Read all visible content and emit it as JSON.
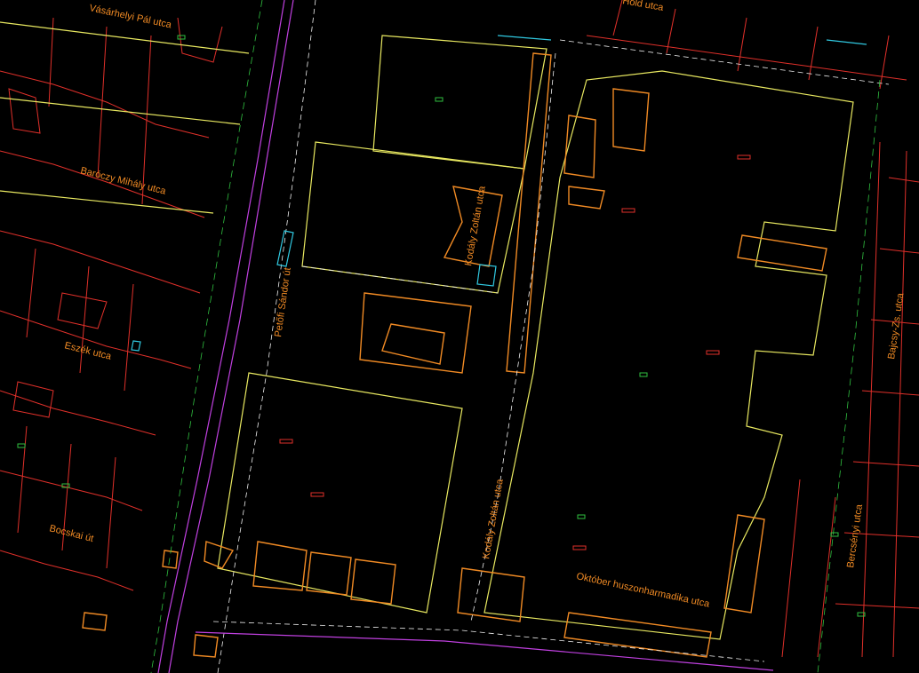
{
  "map": {
    "background": "#000000",
    "colors": {
      "parcel": "#e0302a",
      "building": "#f08a24",
      "block": "#e8e860",
      "tram": "#c040e0",
      "road_line": "#f0f0f0",
      "green_line": "#30c040",
      "cyan": "#30c8e0"
    },
    "street_labels": {
      "vasarhelyi": "Vásárhelyi Pál utca",
      "bercsenyi": "Baróczy Mihály utca",
      "ezzolo": "Eszék utca",
      "bocskai": "Bocskai út",
      "petofi": "Petőfi Sándor út",
      "kodaly_top": "Kodály Zoltán utca",
      "kodaly_bottom": "Kodály Zoltán utca",
      "okt23": "Október huszonharmadika utca",
      "right_1": "Bajcsy-Zs. utca",
      "right_2": "Bercsényi utca",
      "top_right": "Hold utca"
    },
    "layers": [
      "parcels",
      "buildings",
      "blocks",
      "tram-line",
      "roads",
      "street-names"
    ]
  }
}
